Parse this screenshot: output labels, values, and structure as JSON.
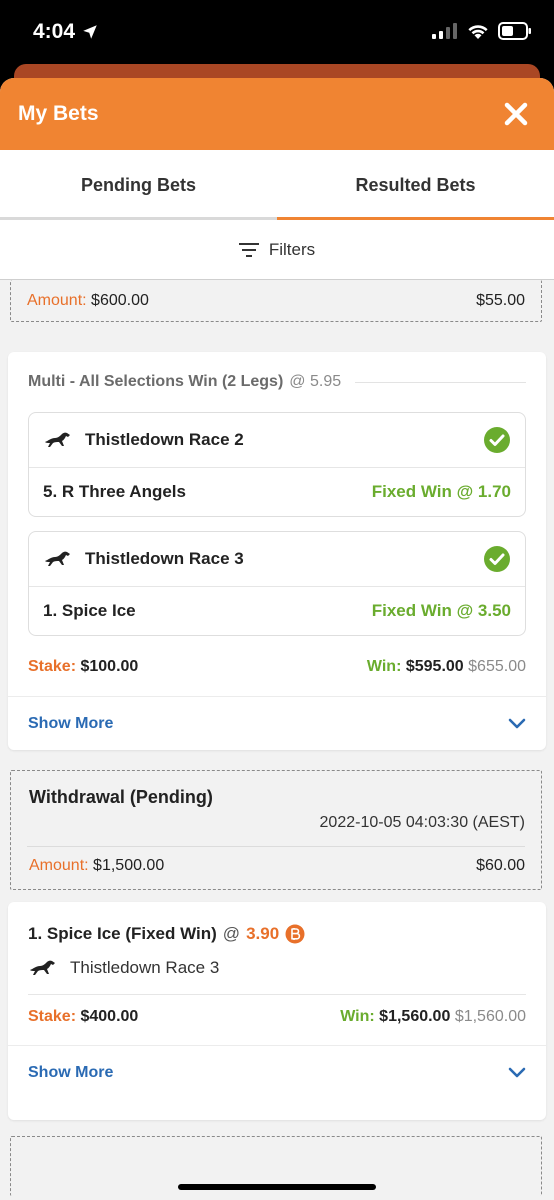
{
  "status": {
    "time": "4:04"
  },
  "header": {
    "title": "My Bets"
  },
  "tabs": [
    {
      "label": "Pending Bets",
      "active": false
    },
    {
      "label": "Resulted Bets",
      "active": true
    }
  ],
  "filters": {
    "label": "Filters"
  },
  "partial_top": {
    "amount_label": "Amount:",
    "amount_value": "$600.00",
    "right_value": "$55.00"
  },
  "multi_bet": {
    "title": "Multi - All Selections Win (2 Legs)",
    "odds": "@ 5.95",
    "legs": [
      {
        "event": "Thistledown Race 2",
        "selection": "5. R Three Angels",
        "bet_type": "Fixed Win @ 1.70"
      },
      {
        "event": "Thistledown Race 3",
        "selection": "1. Spice Ice",
        "bet_type": "Fixed Win @ 3.50"
      }
    ],
    "stake_label": "Stake:",
    "stake_value": "$100.00",
    "win_label": "Win:",
    "win_value": "$595.00",
    "win_alt": "$655.00",
    "show_more": "Show More"
  },
  "withdrawal": {
    "title": "Withdrawal (Pending)",
    "date": "2022-10-05 04:03:30 (AEST)",
    "amount_label": "Amount:",
    "amount_value": "$1,500.00",
    "right_value": "$60.00"
  },
  "single_bet": {
    "title": "1. Spice Ice (Fixed Win)",
    "at": "@",
    "odds": "3.90",
    "event": "Thistledown Race 3",
    "stake_label": "Stake:",
    "stake_value": "$400.00",
    "win_label": "Win:",
    "win_value": "$1,560.00",
    "win_alt": "$1,560.00",
    "show_more": "Show More"
  },
  "colors": {
    "brand": "#f08432",
    "win": "#6aac2e",
    "link": "#2a6ab3"
  }
}
